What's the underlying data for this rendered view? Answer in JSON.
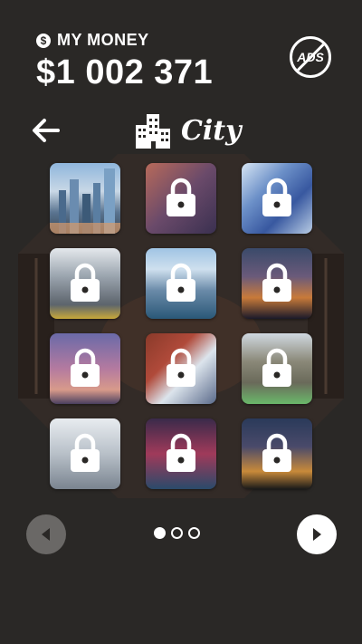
{
  "header": {
    "money_label": "MY MONEY",
    "money_value": "$1 002 371",
    "currency_symbol": "$",
    "no_ads_label": "ADS"
  },
  "category": {
    "title": "City",
    "icon": "city-buildings-icon"
  },
  "tiles": [
    {
      "name": "city-skyline-1",
      "locked": false
    },
    {
      "name": "city-street-1",
      "locked": true
    },
    {
      "name": "city-glass-tower",
      "locked": true
    },
    {
      "name": "city-street-taxi",
      "locked": true
    },
    {
      "name": "city-harbor",
      "locked": true
    },
    {
      "name": "city-night-lights",
      "locked": true
    },
    {
      "name": "city-sunset-towers",
      "locked": true
    },
    {
      "name": "city-bridge",
      "locked": true
    },
    {
      "name": "city-old-buildings",
      "locked": true
    },
    {
      "name": "city-skyscraper-mist",
      "locked": true
    },
    {
      "name": "city-neon-street",
      "locked": true
    },
    {
      "name": "city-night-spires",
      "locked": true
    }
  ],
  "pagination": {
    "total_pages": 3,
    "current_page": 1
  },
  "colors": {
    "background": "#2a2826",
    "prev_button": "#6a6866",
    "next_button": "#ffffff",
    "foreground": "#ffffff"
  }
}
